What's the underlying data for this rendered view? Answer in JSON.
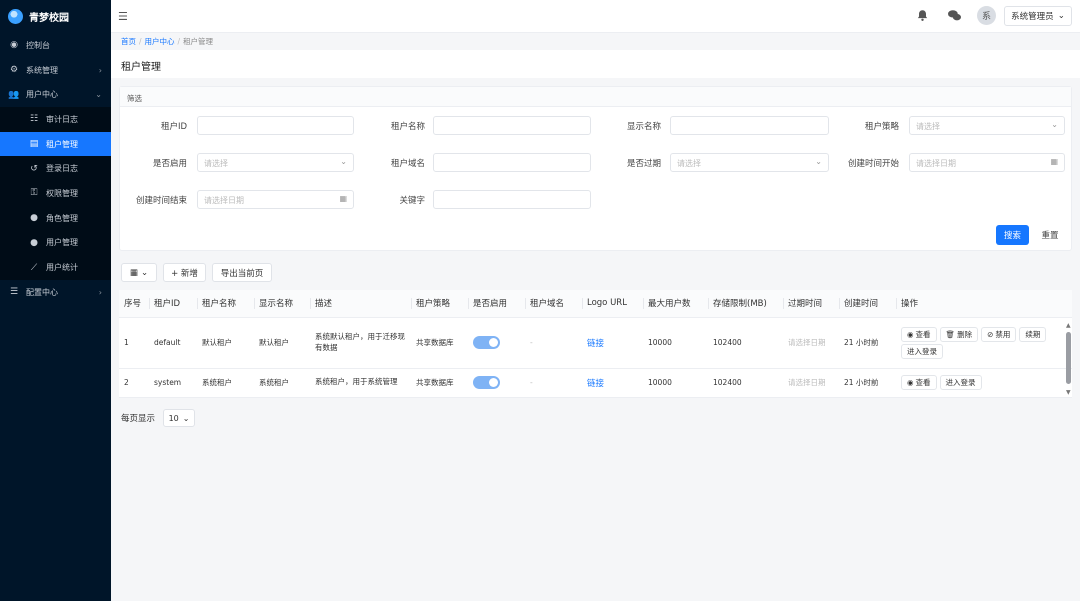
{
  "app": {
    "name": "青梦校园"
  },
  "sidebar": {
    "items": [
      {
        "label": "控制台",
        "icon": "dashboard-icon"
      },
      {
        "label": "系统管理",
        "icon": "gear-icon",
        "chevron": "›"
      },
      {
        "label": "用户中心",
        "icon": "users-icon",
        "chevron": "⌄"
      },
      {
        "label": "审计日志",
        "icon": "list-icon"
      },
      {
        "label": "租户管理",
        "icon": "building-icon",
        "active": true
      },
      {
        "label": "登录日志",
        "icon": "history-icon"
      },
      {
        "label": "权限管理",
        "icon": "key-icon"
      },
      {
        "label": "角色管理",
        "icon": "user-cog-icon"
      },
      {
        "label": "用户管理",
        "icon": "user-group-icon"
      },
      {
        "label": "用户统计",
        "icon": "chart-icon"
      },
      {
        "label": "配置中心",
        "icon": "sliders-icon",
        "chevron": "›"
      }
    ]
  },
  "header": {
    "avatar_text": "系",
    "user_label": "系统管理员"
  },
  "breadcrumb": {
    "home": "首页",
    "parent": "用户中心",
    "current": "租户管理"
  },
  "page": {
    "title": "租户管理"
  },
  "filter": {
    "title": "筛选",
    "tenant_id_label": "租户ID",
    "tenant_name_label": "租户名称",
    "display_name_label": "显示名称",
    "strategy_label": "租户策略",
    "strategy_placeholder": "请选择",
    "enabled_label": "是否启用",
    "enabled_placeholder": "请选择",
    "domain_label": "租户域名",
    "expired_label": "是否过期",
    "expired_placeholder": "请选择",
    "created_start_label": "创建时间开始",
    "created_start_placeholder": "请选择日期",
    "created_end_label": "创建时间结束",
    "created_end_placeholder": "请选择日期",
    "keyword_label": "关键字",
    "search_button": "搜索",
    "reset_button": "重置"
  },
  "toolbar": {
    "add_button": "+ 新增",
    "export_button": "导出当前页"
  },
  "table": {
    "columns": [
      "序号",
      "租户ID",
      "租户名称",
      "显示名称",
      "描述",
      "租户策略",
      "是否启用",
      "租户域名",
      "Logo URL",
      "最大用户数",
      "存储限制(MB)",
      "过期时间",
      "创建时间",
      "操作"
    ],
    "rows": [
      {
        "index": "1",
        "tenant_id": "default",
        "tenant_name": "默认租户",
        "display_name": "默认租户",
        "description": "系统默认租户，用于迁移现有数据",
        "strategy": "共享数据库",
        "enabled": true,
        "domain": "-",
        "logo": "链接",
        "max_users": "10000",
        "storage": "102400",
        "expire": "请选择日期",
        "created": "21 小时前",
        "actions": [
          "查看",
          "删除",
          "禁用",
          "续期",
          "进入登录"
        ]
      },
      {
        "index": "2",
        "tenant_id": "system",
        "tenant_name": "系统租户",
        "display_name": "系统租户",
        "description": "系统租户，用于系统管理",
        "strategy": "共享数据库",
        "enabled": true,
        "domain": "-",
        "logo": "链接",
        "max_users": "10000",
        "storage": "102400",
        "expire": "请选择日期",
        "created": "21 小时前",
        "actions": [
          "查看",
          "进入登录"
        ]
      }
    ]
  },
  "pager": {
    "label": "每页显示",
    "page_size": "10"
  }
}
